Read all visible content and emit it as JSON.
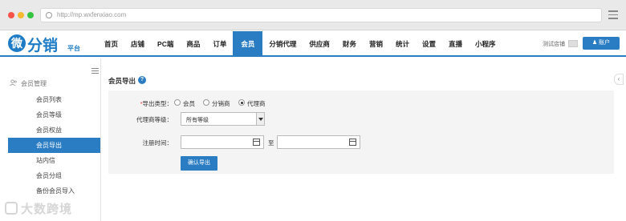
{
  "browser": {
    "url": "http://mp.wxfenxiao.com"
  },
  "logo": {
    "badge": "微",
    "main": "分销",
    "sub": "平台"
  },
  "nav": {
    "items": [
      {
        "label": "首页"
      },
      {
        "label": "店铺"
      },
      {
        "label": "PC端"
      },
      {
        "label": "商品"
      },
      {
        "label": "订单"
      },
      {
        "label": "会员",
        "active": true
      },
      {
        "label": "分销代理"
      },
      {
        "label": "供应商"
      },
      {
        "label": "财务"
      },
      {
        "label": "营销"
      },
      {
        "label": "统计"
      },
      {
        "label": "设置"
      },
      {
        "label": "直播"
      },
      {
        "label": "小程序"
      }
    ],
    "store_name": "测试店铺",
    "account_label": "账户"
  },
  "sidebar": {
    "group_label": "会员管理",
    "items": [
      {
        "label": "会员列表"
      },
      {
        "label": "会员等级"
      },
      {
        "label": "会员权益"
      },
      {
        "label": "会员导出",
        "active": true
      },
      {
        "label": "站内信"
      },
      {
        "label": "会员分组"
      },
      {
        "label": "备份会员导入"
      }
    ]
  },
  "page": {
    "title": "会员导出",
    "help_glyph": "?"
  },
  "form": {
    "export_type_label": "导出类型：",
    "required_mark": "*",
    "export_type_options": [
      {
        "label": "会员",
        "checked": false
      },
      {
        "label": "分销商",
        "checked": false
      },
      {
        "label": "代理商",
        "checked": true
      }
    ],
    "agent_level_label": "代理商等级：",
    "agent_level_value": "所有等级",
    "register_time_label": "注册时间：",
    "to_text": "至",
    "submit_label": "确认导出"
  },
  "watermark": {
    "text": "大数跨境"
  },
  "colors": {
    "accent": "#2b7dc3"
  }
}
